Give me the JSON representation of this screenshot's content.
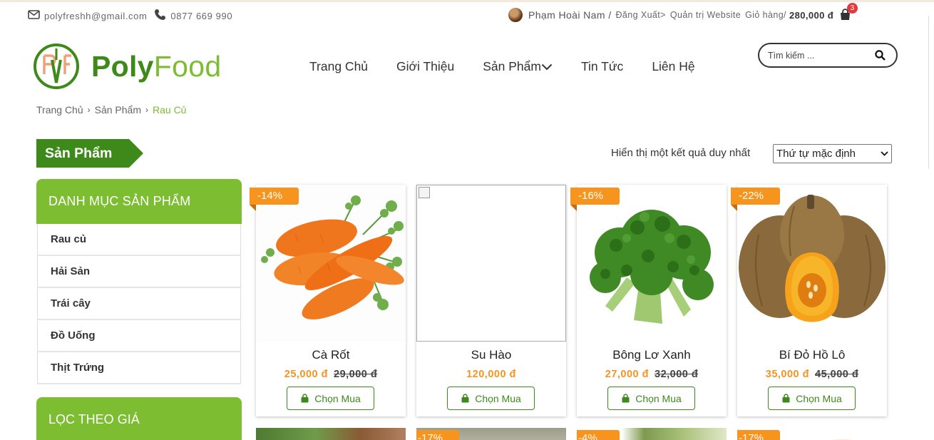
{
  "topbar": {
    "email": "polyfreshh@gmail.com",
    "phone": "0877 669 990",
    "user_name": "Phạm Hoài Nam /",
    "logout": "Đăng Xuất>",
    "admin": "Quản trị Website",
    "cart_label": "Giỏ hàng/",
    "cart_total": "280,000 đ",
    "cart_count": "3"
  },
  "logo": {
    "part1": "Poly",
    "part2": "Food"
  },
  "nav": {
    "items": [
      "Trang Chủ",
      "Giới Thiệu",
      "Sản Phẩm",
      "Tin Tức",
      "Liên Hệ"
    ]
  },
  "search": {
    "placeholder": "Tìm kiếm ..."
  },
  "breadcrumb": [
    "Trang Chủ",
    "Sản Phẩm",
    "Rau Củ"
  ],
  "section": {
    "title": "Sản Phẩm",
    "result_text": "Hiển thị một kết quả duy nhất",
    "sort_selected": "Thứ tự mặc định"
  },
  "sidebar": {
    "category_title": "DANH MỤC SẢN PHẨM",
    "categories": [
      "Rau củ",
      "Hải Sản",
      "Trái cây",
      "Đồ Uống",
      "Thịt Trứng"
    ],
    "filter_title": "LỌC THEO GIÁ"
  },
  "products": [
    {
      "name": "Cà Rốt",
      "price": "25,000 đ",
      "old_price": "29,000 đ",
      "discount": "-14%"
    },
    {
      "name": "Su Hào",
      "price": "120,000 đ",
      "old_price": "",
      "discount": ""
    },
    {
      "name": "Bông Lơ Xanh",
      "price": "27,000 đ",
      "old_price": "32,000 đ",
      "discount": "-16%"
    },
    {
      "name": "Bí Đỏ Hồ Lô",
      "price": "35,000 đ",
      "old_price": "45,000 đ",
      "discount": "-22%"
    }
  ],
  "buy_label": "Chọn Mua",
  "row2_badges": [
    "-17%",
    "-4%",
    "-17%"
  ],
  "colors": {
    "primary": "#3d8a1b",
    "accent": "#7cbd32",
    "orange": "#f7941d"
  },
  "icons": [
    "envelope-icon",
    "phone-icon",
    "avatar",
    "cart-icon",
    "search-icon",
    "chevron-down-icon",
    "shopping-bag-icon"
  ]
}
